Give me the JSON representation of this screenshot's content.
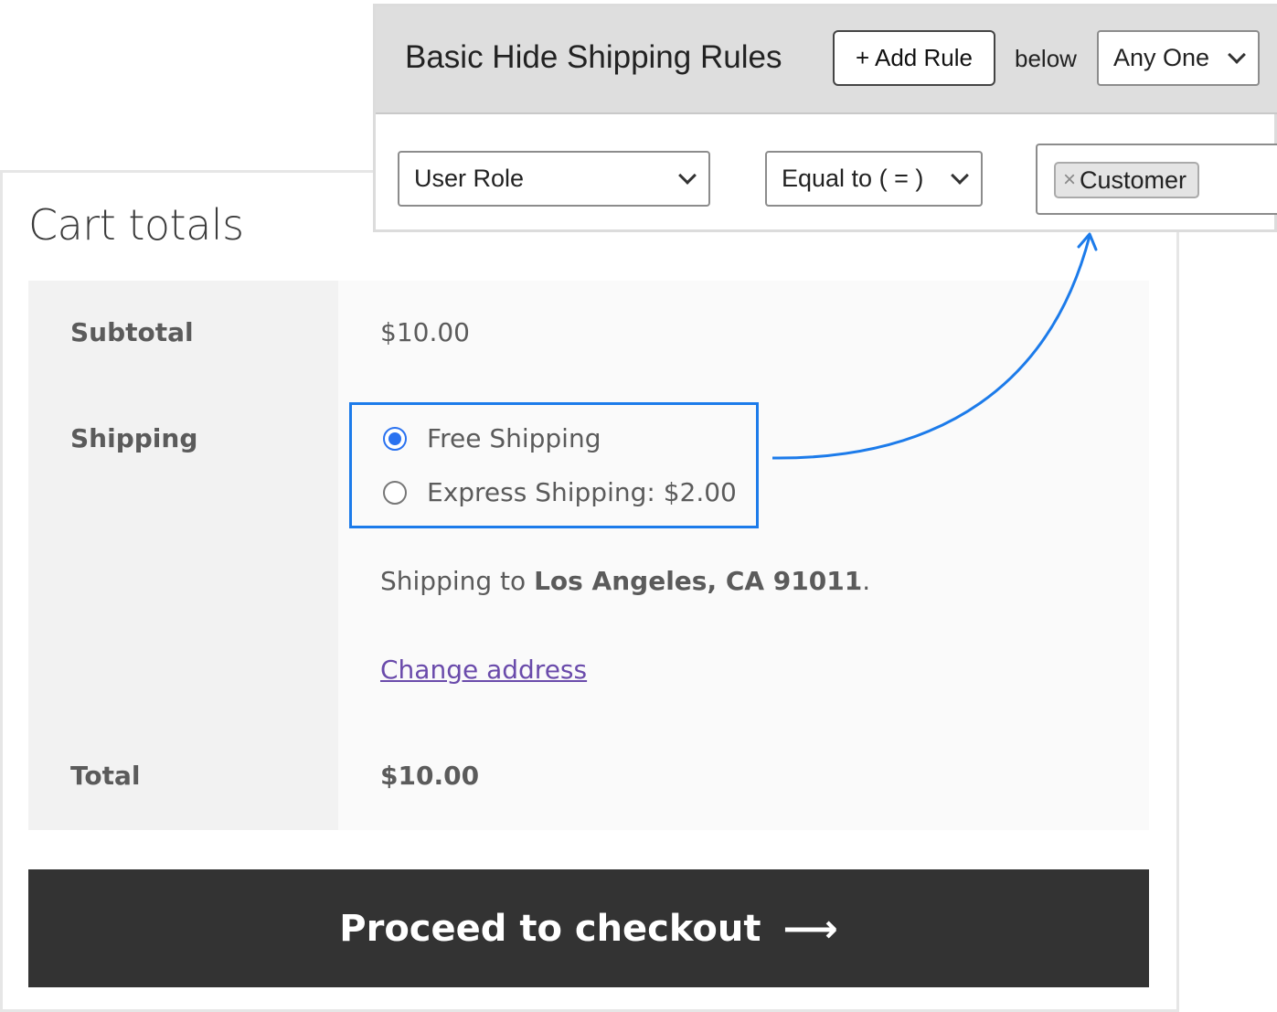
{
  "cart": {
    "title": "Cart totals",
    "rows": {
      "subtotal_label": "Subtotal",
      "subtotal_value": "$10.00",
      "shipping_label": "Shipping",
      "total_label": "Total",
      "total_value": "$10.00"
    },
    "shipping_options": [
      {
        "label": "Free Shipping",
        "selected": true
      },
      {
        "label": "Express Shipping: $2.00",
        "selected": false
      }
    ],
    "shipping_to_prefix": "Shipping to ",
    "shipping_to_location": "Los Angeles, CA 91011",
    "shipping_to_suffix": ".",
    "change_address": "Change address",
    "checkout_label": "Proceed to checkout",
    "checkout_arrow": "⟶"
  },
  "rules": {
    "title": "Basic Hide Shipping Rules",
    "add_rule": "+ Add Rule",
    "below": "below",
    "match_select": "Any One",
    "condition_field": "User Role",
    "condition_operator": "Equal to ( = )",
    "tag_remove": "×",
    "tag_value": "Customer"
  },
  "colors": {
    "highlight": "#1c7bea",
    "radio_checked": "#2a72f0",
    "link": "#6a4bab",
    "checkout_bg": "#333333"
  }
}
